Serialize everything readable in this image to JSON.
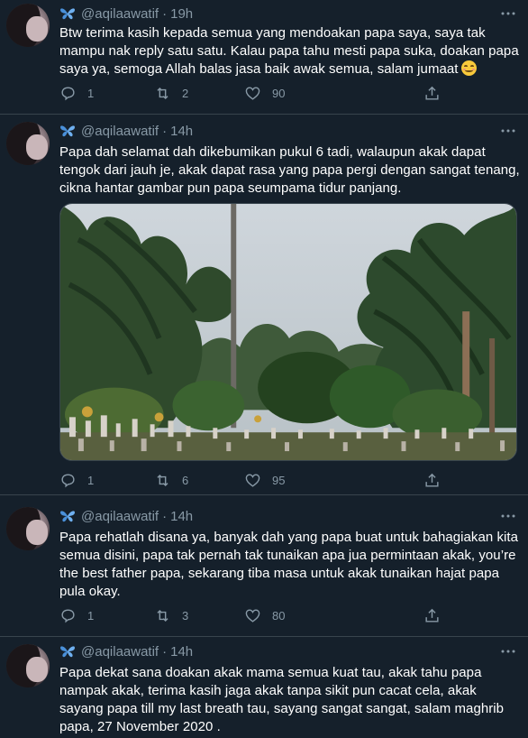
{
  "tweets": [
    {
      "handle": "@aqilaawatif",
      "separator": "·",
      "time": "19h",
      "text": "Btw terima kasih kepada semua yang mendoakan papa saya, saya tak mampu nak reply satu satu. Kalau papa tahu mesti papa suka, doakan papa saya ya, semoga Allah balas jasa baik awak semua, salam jumaat",
      "emoji": "smiling-face-icon",
      "replies": "1",
      "retweets": "2",
      "likes": "90"
    },
    {
      "handle": "@aqilaawatif",
      "separator": "·",
      "time": "14h",
      "text": "Papa dah selamat dah dikebumikan pukul 6 tadi, walaupun akak dapat tengok dari jauh je, akak dapat rasa yang papa pergi dengan sangat tenang, cikna hantar gambar pun papa seumpama tidur panjang.",
      "replies": "1",
      "retweets": "6",
      "likes": "95"
    },
    {
      "handle": "@aqilaawatif",
      "separator": "·",
      "time": "14h",
      "text": "Papa rehatlah disana ya, banyak dah yang papa buat untuk bahagiakan kita semua disini, papa tak pernah tak tunaikan apa jua permintaan akak, you’re the best father papa, sekarang tiba masa untuk akak tunaikan hajat papa pula okay.",
      "replies": "1",
      "retweets": "3",
      "likes": "80"
    },
    {
      "handle": "@aqilaawatif",
      "separator": "·",
      "time": "14h",
      "text": "Papa dekat sana doakan akak mama semua kuat tau, akak tahu papa nampak akak, terima kasih jaga akak tanpa sikit pun cacat cela, akak sayang papa till my last breath tau, sayang sangat sangat, salam maghrib papa, 27 November 2020 ."
    }
  ],
  "colors": {
    "background": "#15202b",
    "secondary_text": "#8899a6",
    "divider": "#38444d",
    "butterfly": "#4a90d9"
  },
  "icons": [
    "butterfly-icon",
    "more-icon",
    "reply-icon",
    "retweet-icon",
    "like-icon",
    "share-icon"
  ]
}
